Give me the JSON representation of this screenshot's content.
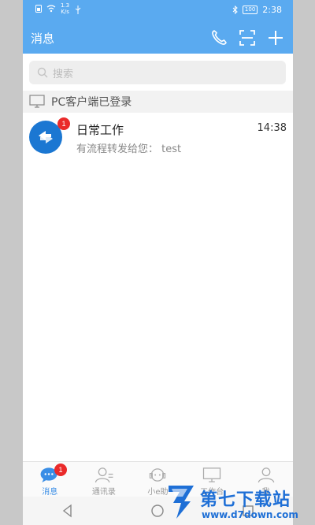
{
  "status_bar": {
    "speed_top": "1.3",
    "speed_unit": "K/s",
    "battery": "100",
    "time": "2:38"
  },
  "header": {
    "title": "消息",
    "icons": [
      "phone-icon",
      "scan-icon",
      "plus-icon"
    ]
  },
  "search": {
    "placeholder": "搜索"
  },
  "pc_notice": {
    "text": "PC客户端已登录"
  },
  "conversations": [
    {
      "name": "日常工作",
      "time": "14:38",
      "preview": "有流程转发给您： test",
      "unread": "1"
    }
  ],
  "tabs": [
    {
      "label": "消息",
      "icon": "chat-icon",
      "badge": "1",
      "active": true
    },
    {
      "label": "通讯录",
      "icon": "contacts-icon"
    },
    {
      "label": "小e助",
      "icon": "assistant-icon"
    },
    {
      "label": "工作台",
      "icon": "workbench-icon"
    },
    {
      "label": "我",
      "icon": "person-icon"
    }
  ],
  "watermark": {
    "title": "第七下载站",
    "url": "www.d7down.com"
  },
  "colors": {
    "accent": "#5aaaf0",
    "badge": "#ea2a2a",
    "avatar": "#1b77d2",
    "tab_active": "#3a8ee6",
    "watermark": "#1e6fd6"
  }
}
